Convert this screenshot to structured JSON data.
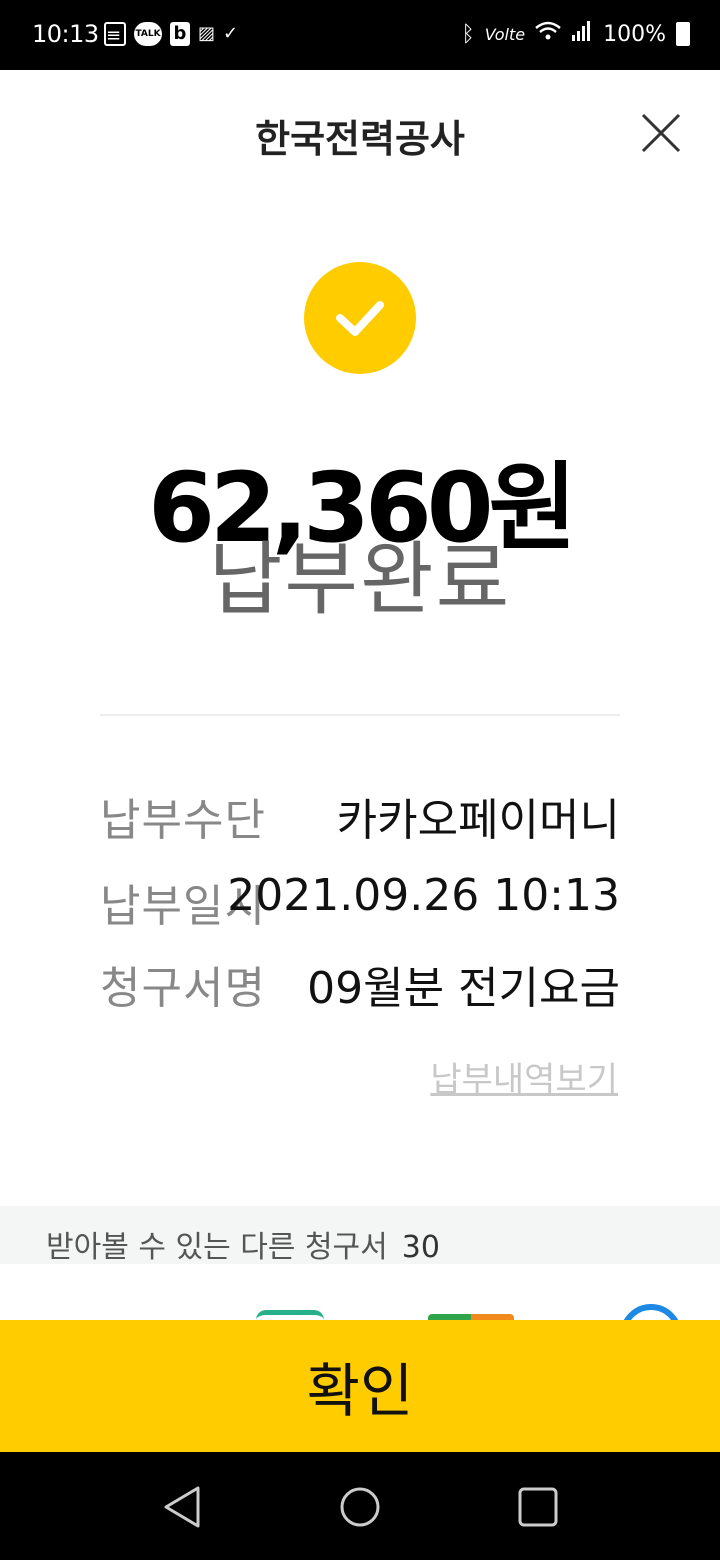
{
  "status_bar": {
    "time": "10:13",
    "network": "Volte",
    "battery": "100%",
    "notification_icons": [
      "message-icon",
      "kakaotalk-icon",
      "b-app-icon",
      "image-icon",
      "check-icon"
    ]
  },
  "header": {
    "title": "한국전력공사"
  },
  "payment": {
    "amount": "62,360원",
    "status": "납부완료"
  },
  "details": [
    {
      "label": "납부수단",
      "value": "카카오페이머니"
    },
    {
      "label": "납부일시",
      "value": "2021.09.26 10:13"
    },
    {
      "label": "청구서명",
      "value": "09월분 전기요금"
    }
  ],
  "history_link": "납부내역보기",
  "other_bills": {
    "label": "받아볼 수 있는 다른 청구서",
    "count": "30"
  },
  "confirm_button": "확인",
  "colors": {
    "accent": "#FFCC00",
    "status_text": "#666666",
    "label_text": "#888888"
  }
}
